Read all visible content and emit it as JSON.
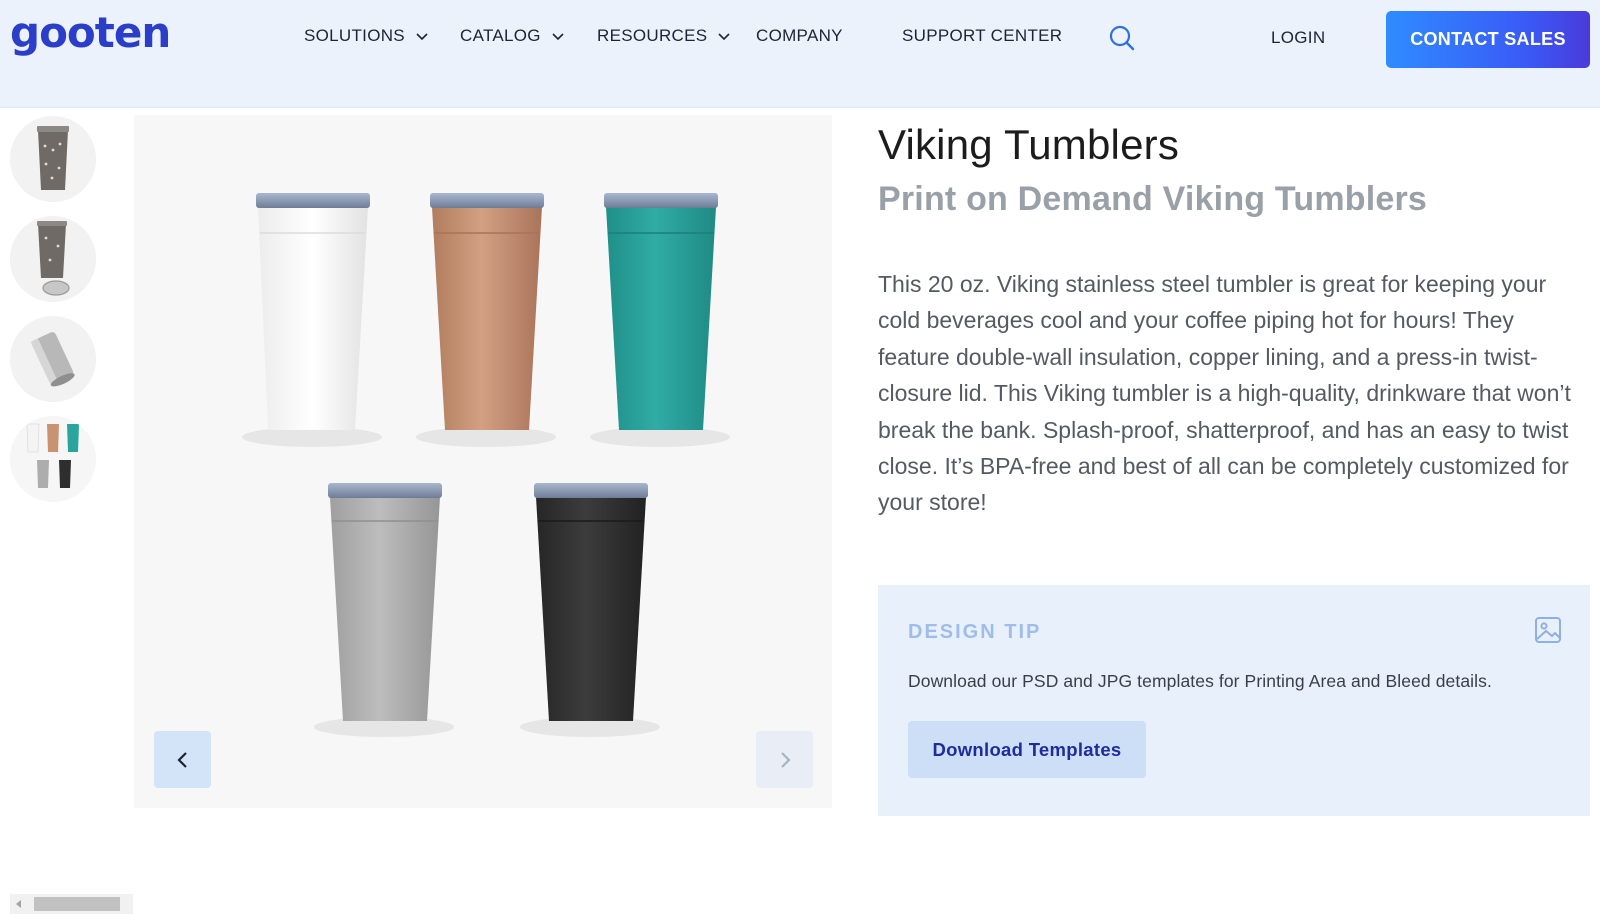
{
  "header": {
    "logo_text": "gooten",
    "nav": [
      {
        "label": "SOLUTIONS",
        "has_dropdown": true
      },
      {
        "label": "CATALOG",
        "has_dropdown": true
      },
      {
        "label": "RESOURCES",
        "has_dropdown": true
      },
      {
        "label": "COMPANY",
        "has_dropdown": false
      },
      {
        "label": "SUPPORT CENTER",
        "has_dropdown": false
      }
    ],
    "search_icon": "search-icon",
    "login_label": "LOGIN",
    "contact_label": "CONTACT SALES"
  },
  "gallery": {
    "thumbnails": [
      {
        "name": "tumbler-steel-front"
      },
      {
        "name": "tumbler-steel-with-lid"
      },
      {
        "name": "tumbler-steel-side"
      },
      {
        "name": "tumbler-colors-group"
      }
    ],
    "tumbler_colors": [
      "#f4f4f4",
      "#c99371",
      "#2aa59e",
      "#adadad",
      "#2e2e2e"
    ],
    "prev_icon": "chevron-left-icon",
    "next_icon": "chevron-right-icon"
  },
  "product": {
    "title": "Viking Tumblers",
    "subtitle": "Print on Demand Viking Tumblers",
    "description": "This 20 oz. Viking stainless steel tumbler is great for keeping your cold beverages cool and your coffee piping hot for hours! They feature double-wall insulation, copper lining, and a press-in twist-closure lid. This Viking tumbler is a high-quality, drinkware that won’t break the bank. Splash-proof, shatterproof, and has an easy to twist close. It’s BPA-free and best of all can be completely customized for your store!"
  },
  "design_tip": {
    "label": "DESIGN TIP",
    "icon": "image-icon",
    "text": "Download our PSD and JPG templates for Printing Area and Bleed details.",
    "button_label": "Download Templates"
  },
  "colors": {
    "brand": "#2a3ec9",
    "header_bg": "#ebf2fc",
    "cta_gradient_start": "#2f8cff",
    "cta_gradient_end": "#4a3ad9",
    "tip_bg": "#e8f0fc"
  }
}
